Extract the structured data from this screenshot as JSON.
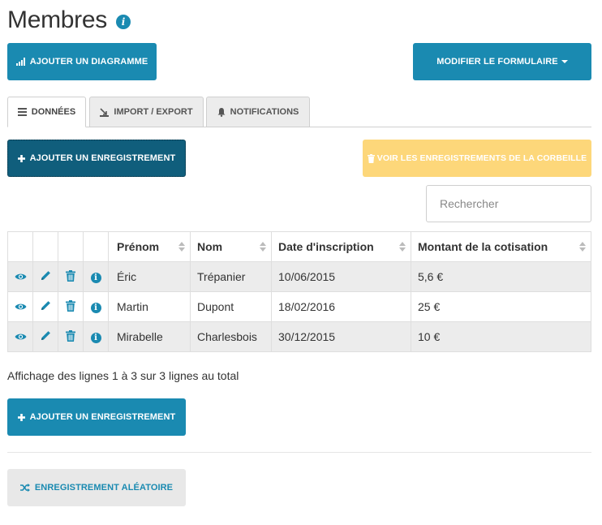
{
  "page": {
    "title": "Membres",
    "info_icon": "i"
  },
  "toolbar": {
    "add_chart_label": "AJOUTER UN DIAGRAMME",
    "modify_form_label": "MODIFIER LE FORMULAIRE"
  },
  "tabs": [
    {
      "label": "DONNÉES",
      "icon": "list-icon",
      "active": true
    },
    {
      "label": "IMPORT / EXPORT",
      "icon": "import-export-icon",
      "active": false
    },
    {
      "label": "NOTIFICATIONS",
      "icon": "bell-icon",
      "active": false
    }
  ],
  "actions": {
    "add_record_label": "AJOUTER UN ENREGISTREMENT",
    "trash_label": "VOIR LES ENREGISTREMENTS DE LA CORBEILLE",
    "add_record_bottom_label": "AJOUTER UN ENREGISTREMENT",
    "random_record_label": "ENREGISTREMENT ALÉATOIRE"
  },
  "search": {
    "placeholder": "Rechercher",
    "value": ""
  },
  "table": {
    "columns": [
      "Prénom",
      "Nom",
      "Date d'inscription",
      "Montant de la cotisation"
    ],
    "rows": [
      [
        "Éric",
        "Trépanier",
        "10/06/2015",
        "5,6 €"
      ],
      [
        "Martin",
        "Dupont",
        "18/02/2016",
        "25 €"
      ],
      [
        "Mirabelle",
        "Charlesbois",
        "30/12/2015",
        "10 €"
      ]
    ],
    "row_icons": [
      "eye-icon",
      "pencil-icon",
      "trash-icon",
      "info-icon"
    ]
  },
  "summary": "Affichage des lignes 1 à 3 sur 3 lignes au total",
  "colors": {
    "primary": "#1a8ab1",
    "primary_dark": "#105e7c",
    "warning": "#fdd77a",
    "row_alt": "#ececec"
  }
}
